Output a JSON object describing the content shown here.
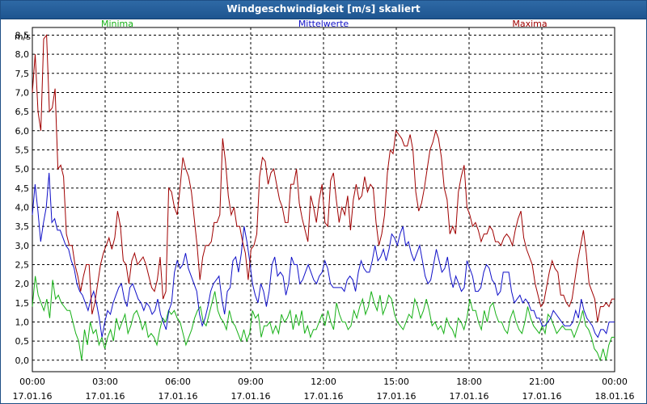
{
  "window": {
    "title": "Windgeschwindigkeit [m/s] skaliert"
  },
  "chart_data": {
    "type": "line",
    "title": "Windgeschwindigkeit [m/s] skaliert",
    "ylabel": "m/s",
    "ylim": [
      -0.3,
      8.7
    ],
    "yticks": [
      "0,0",
      "0,5",
      "1,0",
      "1,5",
      "2,0",
      "2,5",
      "3,0",
      "3,5",
      "4,0",
      "4,5",
      "5,0",
      "5,5",
      "6,0",
      "6,5",
      "7,0",
      "7,5",
      "8,0",
      "8,5"
    ],
    "xlim_hours": [
      0,
      24
    ],
    "xticks": [
      {
        "time": "00:00",
        "date": "17.01.16"
      },
      {
        "time": "03:00",
        "date": "17.01.16"
      },
      {
        "time": "06:00",
        "date": "17.01.16"
      },
      {
        "time": "09:00",
        "date": "17.01.16"
      },
      {
        "time": "12:00",
        "date": "17.01.16"
      },
      {
        "time": "15:00",
        "date": "17.01.16"
      },
      {
        "time": "18:00",
        "date": "17.01.16"
      },
      {
        "time": "21:00",
        "date": "17.01.16"
      },
      {
        "time": "00:00",
        "date": "18.01.16"
      }
    ],
    "grid": true,
    "legend_position": "top",
    "series": [
      {
        "name": "Minima",
        "color": "#16b016",
        "values": [
          1.4,
          2.2,
          1.7,
          1.5,
          1.3,
          1.6,
          1.1,
          2.1,
          1.6,
          1.7,
          1.5,
          1.4,
          1.3,
          1.3,
          1.0,
          0.7,
          0.5,
          0.0,
          0.8,
          0.4,
          1.0,
          0.7,
          0.8,
          0.4,
          0.6,
          0.3,
          0.6,
          0.8,
          0.5,
          1.1,
          0.8,
          1.0,
          1.2,
          0.7,
          0.9,
          1.2,
          1.3,
          1.1,
          0.8,
          1.0,
          0.6,
          0.7,
          0.6,
          0.4,
          0.8,
          1.1,
          1.0,
          1.3,
          1.2,
          1.3,
          1.1,
          1.0,
          0.7,
          0.4,
          0.6,
          0.8,
          1.1,
          1.3,
          1.4,
          1.0,
          0.9,
          1.2,
          1.5,
          1.8,
          1.3,
          1.1,
          1.0,
          0.8,
          1.3,
          1.0,
          0.9,
          0.7,
          0.5,
          0.8,
          0.5,
          0.7,
          1.3,
          1.1,
          1.2,
          0.6,
          0.9,
          0.9,
          1.0,
          0.7,
          0.9,
          0.7,
          1.2,
          1.0,
          1.1,
          1.3,
          0.8,
          1.2,
          0.9,
          1.3,
          0.7,
          0.9,
          0.6,
          0.8,
          0.8,
          1.0,
          1.2,
          0.9,
          1.3,
          1.0,
          0.8,
          1.5,
          1.2,
          1.0,
          1.0,
          0.8,
          0.9,
          1.3,
          1.1,
          1.4,
          1.6,
          1.2,
          1.4,
          1.8,
          1.5,
          1.3,
          1.7,
          1.2,
          1.4,
          1.7,
          1.6,
          1.2,
          1.0,
          0.9,
          0.8,
          1.0,
          1.2,
          1.1,
          1.6,
          1.4,
          1.1,
          1.3,
          1.6,
          1.3,
          0.9,
          1.0,
          0.8,
          0.9,
          0.7,
          1.1,
          0.9,
          0.8,
          0.6,
          1.1,
          1.0,
          0.8,
          1.1,
          1.6,
          1.3,
          1.3,
          1.0,
          0.8,
          1.3,
          1.0,
          1.4,
          1.5,
          1.2,
          1.0,
          1.0,
          0.8,
          0.7,
          1.1,
          1.3,
          1.0,
          0.8,
          0.7,
          1.0,
          1.4,
          1.1,
          0.9,
          0.8,
          0.7,
          0.9,
          0.7,
          1.2,
          1.1,
          0.9,
          0.7,
          0.8,
          0.9,
          0.8,
          0.8,
          0.8,
          0.6,
          0.8,
          1.0,
          1.3,
          0.9,
          0.8,
          0.6,
          0.3,
          0.2,
          0.0,
          0.3,
          0.0,
          0.4,
          0.6,
          0.6
        ]
      },
      {
        "name": "Mittelwerte",
        "color": "#1010c8",
        "values": [
          3.8,
          4.6,
          3.9,
          3.1,
          3.6,
          4.0,
          4.9,
          3.6,
          3.7,
          3.4,
          3.4,
          3.2,
          3.0,
          2.9,
          2.6,
          2.4,
          2.0,
          1.8,
          1.7,
          1.5,
          1.3,
          1.6,
          1.8,
          1.5,
          1.1,
          0.6,
          1.0,
          1.3,
          1.2,
          1.5,
          1.7,
          1.9,
          2.0,
          1.6,
          1.4,
          1.9,
          2.0,
          1.8,
          1.6,
          1.5,
          1.3,
          1.5,
          1.4,
          1.2,
          1.3,
          1.6,
          1.2,
          1.0,
          0.8,
          1.3,
          1.5,
          2.3,
          2.6,
          2.4,
          2.5,
          2.8,
          2.4,
          2.2,
          2.0,
          1.8,
          1.2,
          0.9,
          1.1,
          1.4,
          1.8,
          2.0,
          2.1,
          2.2,
          1.6,
          1.2,
          1.8,
          1.9,
          2.6,
          2.7,
          2.3,
          2.8,
          3.5,
          3.1,
          2.6,
          2.0,
          1.7,
          1.5,
          2.0,
          1.8,
          1.4,
          1.8,
          2.5,
          2.7,
          2.2,
          2.3,
          2.2,
          1.7,
          2.0,
          2.7,
          2.5,
          2.5,
          2.0,
          2.1,
          2.3,
          2.5,
          2.3,
          2.1,
          2.0,
          2.2,
          2.3,
          2.6,
          2.4,
          2.0,
          1.9,
          1.9,
          1.9,
          1.9,
          1.8,
          2.1,
          2.2,
          2.1,
          1.8,
          2.3,
          2.6,
          2.4,
          2.3,
          2.3,
          2.6,
          3.0,
          2.6,
          2.7,
          2.9,
          2.6,
          2.9,
          3.3,
          3.2,
          3.0,
          3.3,
          3.5,
          3.0,
          3.1,
          2.8,
          2.6,
          2.8,
          3.0,
          2.6,
          2.2,
          2.0,
          2.1,
          2.5,
          2.9,
          2.6,
          2.3,
          2.4,
          2.7,
          2.2,
          1.9,
          2.2,
          2.0,
          1.8,
          1.9,
          2.6,
          2.4,
          2.2,
          1.8,
          1.8,
          1.9,
          2.3,
          2.5,
          2.4,
          2.1,
          2.0,
          1.7,
          1.8,
          2.3,
          2.3,
          2.3,
          1.8,
          1.5,
          1.6,
          1.7,
          1.5,
          1.6,
          1.5,
          1.3,
          1.3,
          1.1,
          1.1,
          0.9,
          0.9,
          1.0,
          1.1,
          1.3,
          1.2,
          1.1,
          1.0,
          0.9,
          0.9,
          0.9,
          1.0,
          1.3,
          1.1,
          1.6,
          1.3,
          1.1,
          1.0,
          0.9,
          0.7,
          0.6,
          0.8,
          0.8,
          0.7,
          1.0,
          1.0,
          1.0
        ]
      },
      {
        "name": "Maxima",
        "color": "#a00000",
        "values": [
          7.0,
          8.0,
          6.5,
          6.0,
          8.4,
          8.5,
          6.5,
          6.6,
          7.1,
          5.0,
          5.1,
          4.8,
          3.3,
          3.0,
          3.0,
          2.5,
          2.2,
          1.8,
          2.2,
          2.5,
          2.5,
          1.2,
          1.5,
          2.0,
          2.5,
          2.8,
          3.0,
          3.2,
          2.9,
          3.2,
          3.9,
          3.5,
          2.6,
          2.5,
          2.0,
          2.6,
          2.8,
          2.5,
          2.6,
          2.7,
          2.5,
          2.2,
          1.9,
          1.8,
          2.1,
          2.7,
          1.6,
          1.8,
          4.5,
          4.4,
          4.0,
          3.8,
          4.5,
          5.3,
          5.0,
          4.8,
          4.4,
          3.7,
          3.0,
          2.1,
          2.7,
          3.0,
          3.0,
          3.1,
          3.6,
          3.6,
          3.8,
          5.8,
          5.2,
          4.3,
          3.8,
          4.0,
          3.5,
          3.5,
          3.1,
          2.8,
          2.1,
          2.9,
          3.0,
          3.3,
          4.8,
          5.3,
          5.2,
          4.6,
          4.9,
          5.0,
          4.6,
          4.2,
          4.0,
          3.6,
          3.6,
          4.6,
          4.6,
          5.0,
          4.1,
          3.7,
          3.4,
          3.1,
          4.3,
          4.0,
          3.6,
          4.2,
          4.6,
          3.6,
          3.5,
          4.7,
          4.9,
          4.2,
          3.6,
          4.0,
          3.8,
          4.3,
          3.4,
          4.2,
          4.6,
          4.2,
          4.3,
          4.8,
          4.4,
          4.6,
          4.5,
          3.6,
          3.0,
          3.3,
          3.8,
          4.9,
          5.5,
          5.4,
          6.0,
          5.9,
          5.8,
          5.6,
          5.6,
          5.9,
          5.5,
          4.4,
          3.9,
          4.1,
          4.5,
          5.0,
          5.5,
          5.7,
          6.0,
          5.8,
          5.3,
          4.5,
          4.2,
          3.3,
          3.5,
          3.3,
          4.4,
          4.8,
          5.1,
          4.0,
          3.8,
          3.5,
          3.6,
          3.4,
          3.1,
          3.3,
          3.3,
          3.5,
          3.4,
          3.1,
          3.1,
          3.0,
          3.2,
          3.3,
          3.2,
          3.0,
          3.4,
          3.7,
          3.9,
          3.2,
          2.9,
          2.7,
          2.5,
          2.0,
          1.7,
          1.4,
          1.5,
          1.9,
          2.3,
          2.6,
          2.4,
          2.3,
          1.7,
          1.7,
          1.5,
          1.4,
          1.6,
          2.1,
          2.6,
          3.0,
          3.4,
          2.8,
          2.0,
          1.8,
          1.6,
          1.0,
          1.4,
          1.4,
          1.5,
          1.4,
          1.6,
          1.6
        ]
      }
    ]
  }
}
